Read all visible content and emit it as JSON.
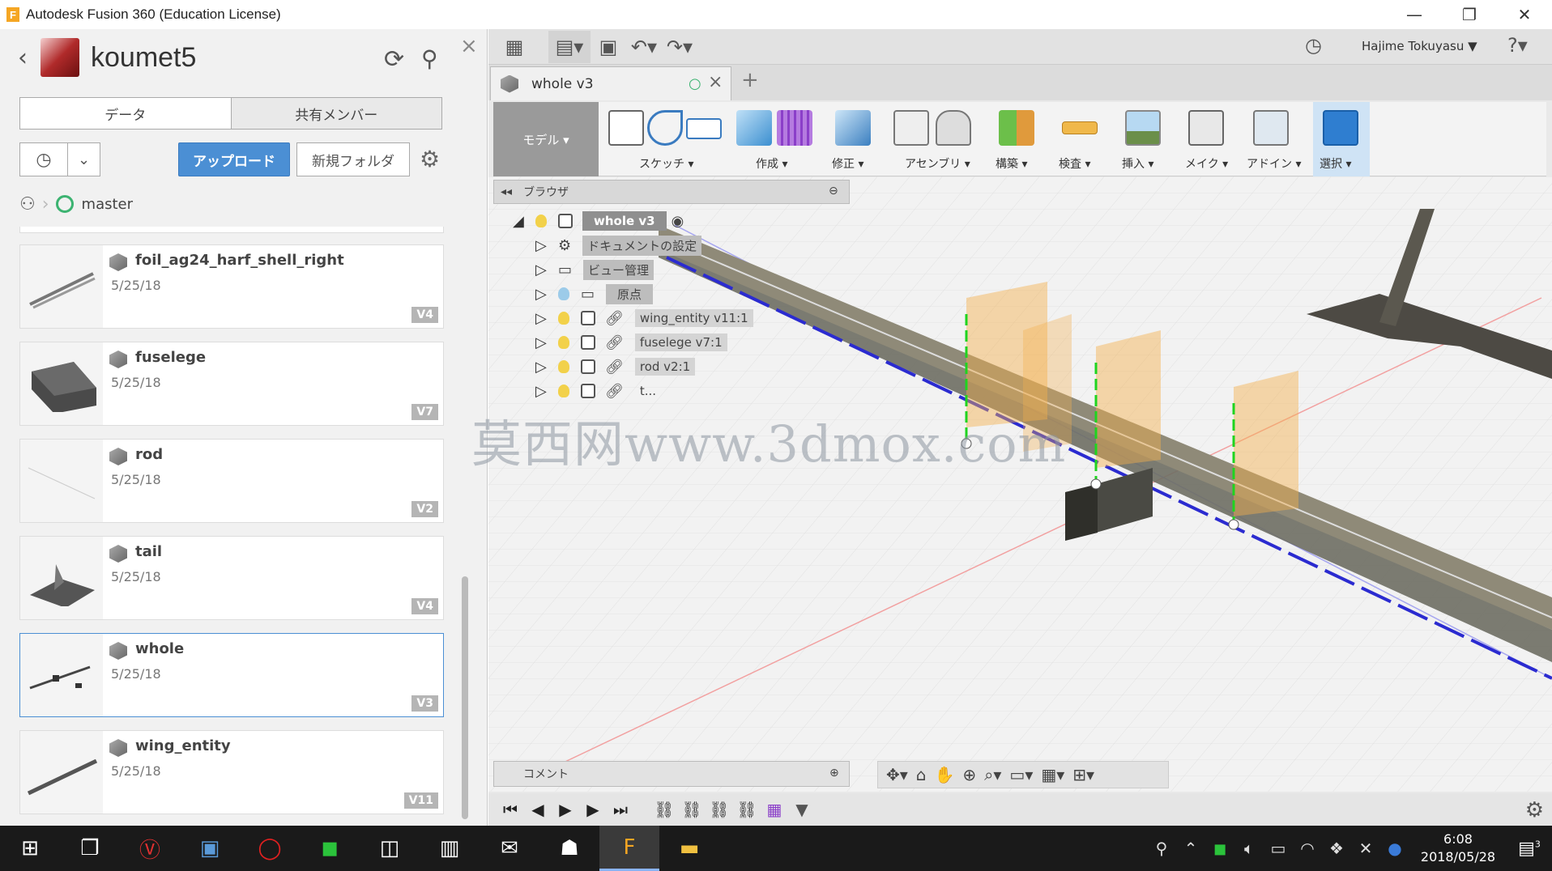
{
  "window": {
    "title": "Autodesk Fusion 360 (Education License)",
    "minimize": "—",
    "restore": "❐",
    "close": "✕"
  },
  "data_panel": {
    "project_name": "koumet5",
    "tabs": [
      "データ",
      "共有メンバー"
    ],
    "upload_label": "アップロード",
    "new_folder_label": "新規フォルダ",
    "branch_name": "master",
    "files": [
      {
        "name": "foil_ag24_harf_shell_right",
        "date": "5/25/18",
        "version": "V4"
      },
      {
        "name": "fuselege",
        "date": "5/25/18",
        "version": "V7"
      },
      {
        "name": "rod",
        "date": "5/25/18",
        "version": "V2"
      },
      {
        "name": "tail",
        "date": "5/25/18",
        "version": "V4"
      },
      {
        "name": "whole",
        "date": "5/25/18",
        "version": "V3"
      },
      {
        "name": "wing_entity",
        "date": "5/25/18",
        "version": "V11"
      }
    ]
  },
  "topbar": {
    "user_name": "Hajime Tokuyasu ▼"
  },
  "document_tab": {
    "title": "whole v3"
  },
  "ribbon": {
    "mode": "モデル ▾",
    "groups": [
      {
        "label": "スケッチ ▾"
      },
      {
        "label": "作成 ▾"
      },
      {
        "label": "修正 ▾"
      },
      {
        "label": "アセンブリ ▾"
      },
      {
        "label": "構築 ▾"
      },
      {
        "label": "検査 ▾"
      },
      {
        "label": "挿入 ▾"
      },
      {
        "label": "メイク ▾"
      },
      {
        "label": "アドイン ▾"
      },
      {
        "label": "選択 ▾"
      }
    ]
  },
  "browser": {
    "header": "ブラウザ",
    "root": "whole v3",
    "items": [
      {
        "label": "ドキュメントの設定"
      },
      {
        "label": "ビュー管理"
      },
      {
        "label": "原点"
      },
      {
        "label": "wing_entity v11:1"
      },
      {
        "label": "fuselege v7:1"
      },
      {
        "label": "rod v2:1"
      },
      {
        "label": "t..."
      }
    ]
  },
  "comment_bar": {
    "label": "コメント"
  },
  "watermark": "莫西网www.3dmox.com",
  "taskbar": {
    "time": "6:08",
    "date": "2018/05/28",
    "notifications": "3"
  },
  "colors": {
    "accent_blue": "#4b8fd4",
    "branch_green": "#3cb371",
    "construction_orange": "#f5a623"
  }
}
